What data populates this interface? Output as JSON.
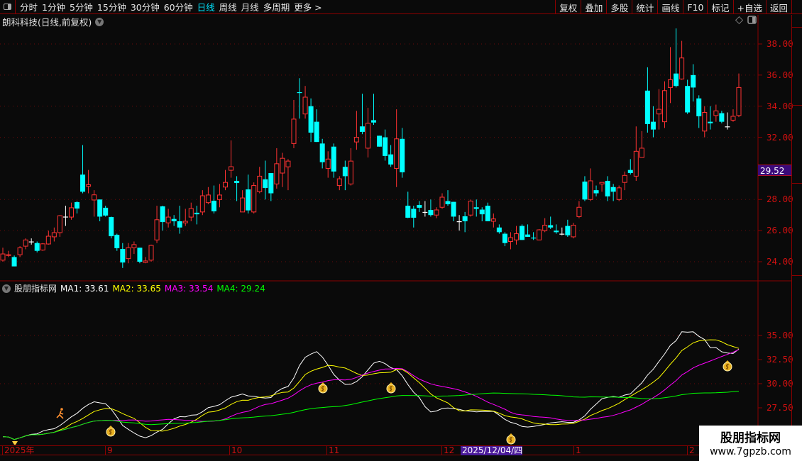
{
  "toolbar": {
    "periods": [
      "分时",
      "1分钟",
      "5分钟",
      "15分钟",
      "30分钟",
      "60分钟",
      "日线",
      "周线",
      "月线",
      "多周期",
      "更多 >"
    ],
    "active_period": "日线",
    "buttons": [
      "复权",
      "叠加",
      "多股",
      "统计",
      "画线",
      "F10",
      "标记",
      "+自选",
      "返回"
    ]
  },
  "main_title": "朗科科技(日线,前复权)",
  "current_price_label": "29.52",
  "indicator": {
    "name": "股朋指标网",
    "ma1_label": "MA1:",
    "ma1": "33.61",
    "ma2_label": "MA2:",
    "ma2": "33.65",
    "ma3_label": "MA3:",
    "ma3": "33.54",
    "ma4_label": "MA4:",
    "ma4": "29.24"
  },
  "date_axis": {
    "labels": [
      "2025年",
      "9",
      "10",
      "11",
      "12",
      "1",
      "2"
    ],
    "highlight": "2025/12/04/四"
  },
  "watermark": {
    "title": "股朋指标网",
    "url": "www.7gpzb.com"
  },
  "colors": {
    "up": "#ff3232",
    "down": "#00ffff",
    "flat": "#ffffff",
    "ma1": "#ffffff",
    "ma2": "#ffff00",
    "ma3": "#ff00ff",
    "ma4": "#00ff00",
    "axis": "#d01010"
  },
  "chart_data": {
    "type": "candlestick",
    "price_axis": {
      "ticks": [
        "38.00",
        "36.00",
        "34.00",
        "32.00",
        "28.00",
        "26.00",
        "24.00"
      ],
      "range": [
        23.2,
        39.2
      ]
    },
    "indicator_axis": {
      "ticks": [
        "35.00",
        "32.50",
        "30.00",
        "27.50"
      ],
      "range": [
        22.8,
        37.2
      ]
    },
    "ma_periods": [
      5,
      10,
      20,
      60
    ],
    "ohlc": [
      [
        24.1,
        24.5,
        24.9,
        24.0
      ],
      [
        24.4,
        24.45,
        24.7,
        24.3
      ],
      [
        24.3,
        23.7,
        24.4,
        23.7
      ],
      [
        24.45,
        24.9,
        25.0,
        24.3
      ],
      [
        25.0,
        25.4,
        25.5,
        24.8
      ],
      [
        25.3,
        25.3,
        25.5,
        25.1
      ],
      [
        25.2,
        24.7,
        25.3,
        24.6
      ],
      [
        24.75,
        25.15,
        25.2,
        24.7
      ],
      [
        25.14,
        25.64,
        26.0,
        25.1
      ],
      [
        25.6,
        25.87,
        26.2,
        25.3
      ],
      [
        25.87,
        26.96,
        27.0,
        25.6
      ],
      [
        26.9,
        26.9,
        27.6,
        26.3
      ],
      [
        26.87,
        27.47,
        27.8,
        26.7
      ],
      [
        27.83,
        27.42,
        27.9,
        27.1
      ],
      [
        29.6,
        28.5,
        31.5,
        28.4
      ],
      [
        28.85,
        28.95,
        29.9,
        28.4
      ],
      [
        27.97,
        28.3,
        28.6,
        26.9
      ],
      [
        28.0,
        26.9,
        28.0,
        26.6
      ],
      [
        27.47,
        26.97,
        27.6,
        26.9
      ],
      [
        26.87,
        25.64,
        26.9,
        25.5
      ],
      [
        25.73,
        24.87,
        25.8,
        24.7
      ],
      [
        24.82,
        23.95,
        25.2,
        23.6
      ],
      [
        24.2,
        24.9,
        25.2,
        23.9
      ],
      [
        24.9,
        25.1,
        25.3,
        24.5
      ],
      [
        24.9,
        24.0,
        24.9,
        23.9
      ],
      [
        23.95,
        24.05,
        24.3,
        23.9
      ],
      [
        24.1,
        25.05,
        25.1,
        24.0
      ],
      [
        25.4,
        26.7,
        27.6,
        25.2
      ],
      [
        27.56,
        26.55,
        27.6,
        26.0
      ],
      [
        26.5,
        26.87,
        27.4,
        26.2
      ],
      [
        26.75,
        26.6,
        27.0,
        26.3
      ],
      [
        26.6,
        26.2,
        27.6,
        25.8
      ],
      [
        26.5,
        26.6,
        27.4,
        26.3
      ],
      [
        26.87,
        27.42,
        27.8,
        26.6
      ],
      [
        27.15,
        27.05,
        27.6,
        26.4
      ],
      [
        27.2,
        28.24,
        28.6,
        27.0
      ],
      [
        27.8,
        28.29,
        28.8,
        27.7
      ],
      [
        27.92,
        27.24,
        28.9,
        27.1
      ],
      [
        28.0,
        28.29,
        29.0,
        27.5
      ],
      [
        28.8,
        29.1,
        29.9,
        28.6
      ],
      [
        29.88,
        30.11,
        31.8,
        29.4
      ],
      [
        29.2,
        29.06,
        29.5,
        27.9
      ],
      [
        27.2,
        28.1,
        28.6,
        27.2
      ],
      [
        28.65,
        27.3,
        29.6,
        27.1
      ],
      [
        27.2,
        28.9,
        29.1,
        27.1
      ],
      [
        28.5,
        29.5,
        30.1,
        28.4
      ],
      [
        29.3,
        28.74,
        30.5,
        28.0
      ],
      [
        29.7,
        28.4,
        29.7,
        27.9
      ],
      [
        29.0,
        30.3,
        31.3,
        28.7
      ],
      [
        29.7,
        30.65,
        31.0,
        28.8
      ],
      [
        30.1,
        30.47,
        30.6,
        28.6
      ],
      [
        31.6,
        33.17,
        34.4,
        31.3
      ],
      [
        34.9,
        34.85,
        35.8,
        33.2
      ],
      [
        33.5,
        34.58,
        35.3,
        33.2
      ],
      [
        34.0,
        32.3,
        34.5,
        31.7
      ],
      [
        33.0,
        31.7,
        33.8,
        31.7
      ],
      [
        31.6,
        30.4,
        31.9,
        30.0
      ],
      [
        30.0,
        30.6,
        31.1,
        29.4
      ],
      [
        31.4,
        29.8,
        31.6,
        29.4
      ],
      [
        28.9,
        29.33,
        29.5,
        28.6
      ],
      [
        30.1,
        29.5,
        30.5,
        28.6
      ],
      [
        29.0,
        30.47,
        31.3,
        28.9
      ],
      [
        31.7,
        32.0,
        33.7,
        31.2
      ],
      [
        32.7,
        32.35,
        34.8,
        32.2
      ],
      [
        31.3,
        32.9,
        33.9,
        30.7
      ],
      [
        33.1,
        32.95,
        34.8,
        32.8
      ],
      [
        32.1,
        31.4,
        32.1,
        31.4
      ],
      [
        32.0,
        30.8,
        32.5,
        30.5
      ],
      [
        30.9,
        30.25,
        31.5,
        30.1
      ],
      [
        30.0,
        31.9,
        33.8,
        28.8
      ],
      [
        31.9,
        29.75,
        32.6,
        29.4
      ],
      [
        27.6,
        26.83,
        28.5,
        26.8
      ],
      [
        27.4,
        26.83,
        27.6,
        26.2
      ],
      [
        27.65,
        27.47,
        27.9,
        27.2
      ],
      [
        27.2,
        27.2,
        27.9,
        26.9
      ],
      [
        27.33,
        27.0,
        28.0,
        26.9
      ],
      [
        27.0,
        27.33,
        27.5,
        26.8
      ],
      [
        27.5,
        28.15,
        28.4,
        27.4
      ],
      [
        27.9,
        27.7,
        28.6,
        27.6
      ],
      [
        27.85,
        26.9,
        27.85,
        26.6
      ],
      [
        26.6,
        26.6,
        27.0,
        26.0
      ],
      [
        26.92,
        26.6,
        27.2,
        25.9
      ],
      [
        27.0,
        27.9,
        28.0,
        26.9
      ],
      [
        27.5,
        27.4,
        28.0,
        26.9
      ],
      [
        27.35,
        27.05,
        27.5,
        26.6
      ],
      [
        27.6,
        26.6,
        27.8,
        26.6
      ],
      [
        26.6,
        26.75,
        27.1,
        26.2
      ],
      [
        26.2,
        25.9,
        26.4,
        25.8
      ],
      [
        25.8,
        25.2,
        25.9,
        25.0
      ],
      [
        25.3,
        25.55,
        25.9,
        24.8
      ],
      [
        25.4,
        25.8,
        26.3,
        25.1
      ],
      [
        26.3,
        25.4,
        26.4,
        25.4
      ],
      [
        25.75,
        25.6,
        26.4,
        25.6
      ],
      [
        25.55,
        25.5,
        25.9,
        25.4
      ],
      [
        25.4,
        26.05,
        26.1,
        25.4
      ],
      [
        26.0,
        26.35,
        26.8,
        25.9
      ],
      [
        26.35,
        26.2,
        26.9,
        26.1
      ],
      [
        26.0,
        25.9,
        26.4,
        25.8
      ],
      [
        25.8,
        25.8,
        26.2,
        25.7
      ],
      [
        26.3,
        25.7,
        26.7,
        25.6
      ],
      [
        25.6,
        26.35,
        26.5,
        25.5
      ],
      [
        26.9,
        27.5,
        27.9,
        26.8
      ],
      [
        29.15,
        28.0,
        29.5,
        27.9
      ],
      [
        28.0,
        29.2,
        30.0,
        27.9
      ],
      [
        28.6,
        28.4,
        28.9,
        28.2
      ],
      [
        29.0,
        29.1,
        29.1,
        28.5
      ],
      [
        29.2,
        28.2,
        29.5,
        27.9
      ],
      [
        28.8,
        28.5,
        29.0,
        27.9
      ],
      [
        28.0,
        28.75,
        28.9,
        27.9
      ],
      [
        29.1,
        29.55,
        29.8,
        28.6
      ],
      [
        29.9,
        29.7,
        30.6,
        29.6
      ],
      [
        29.5,
        31.1,
        32.7,
        29.2
      ],
      [
        30.7,
        31.3,
        32.4,
        30.7
      ],
      [
        35.0,
        32.85,
        36.5,
        32.3
      ],
      [
        33.0,
        32.5,
        34.0,
        32.0
      ],
      [
        33.5,
        33.8,
        35.1,
        32.5
      ],
      [
        33.0,
        35.0,
        35.6,
        32.6
      ],
      [
        35.2,
        35.7,
        37.8,
        34.2
      ],
      [
        36.1,
        35.3,
        39.0,
        35.2
      ],
      [
        35.75,
        37.1,
        38.2,
        35.7
      ],
      [
        35.3,
        33.6,
        35.7,
        33.5
      ],
      [
        36.0,
        35.2,
        36.7,
        34.3
      ],
      [
        34.5,
        33.35,
        34.7,
        32.6
      ],
      [
        32.4,
        33.6,
        34.0,
        32.0
      ],
      [
        33.0,
        32.9,
        34.0,
        32.5
      ],
      [
        33.4,
        33.7,
        34.1,
        33.0
      ],
      [
        33.55,
        33.0,
        33.7,
        32.9
      ],
      [
        32.7,
        32.7,
        33.6,
        32.5
      ],
      [
        33.1,
        33.35,
        33.8,
        33.0
      ],
      [
        33.4,
        35.2,
        36.1,
        33.3
      ]
    ]
  }
}
